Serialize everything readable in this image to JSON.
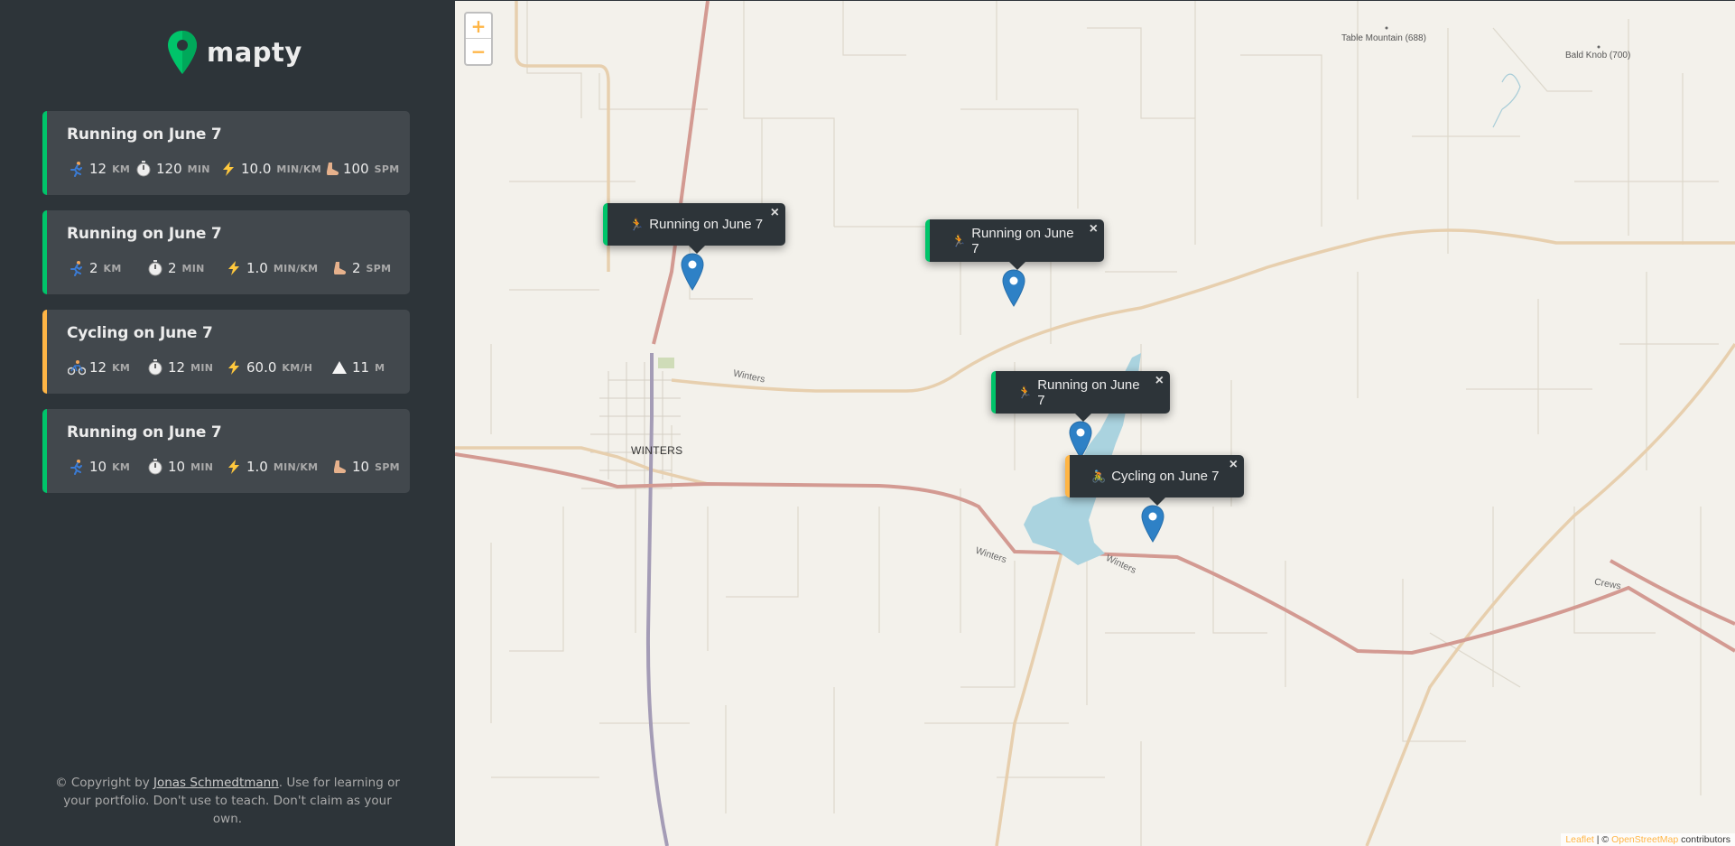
{
  "app": {
    "name": "mapty"
  },
  "workouts": [
    {
      "type": "running",
      "title": "Running on June 7",
      "distance": "12",
      "distance_unit": "km",
      "duration": "120",
      "duration_unit": "min",
      "pace": "10.0",
      "pace_unit": "min/km",
      "cadence": "100",
      "cadence_unit": "spm"
    },
    {
      "type": "running",
      "title": "Running on June 7",
      "distance": "2",
      "distance_unit": "km",
      "duration": "2",
      "duration_unit": "min",
      "pace": "1.0",
      "pace_unit": "min/km",
      "cadence": "2",
      "cadence_unit": "spm"
    },
    {
      "type": "cycling",
      "title": "Cycling on June 7",
      "distance": "12",
      "distance_unit": "km",
      "duration": "12",
      "duration_unit": "min",
      "speed": "60.0",
      "speed_unit": "km/h",
      "elevation": "11",
      "elevation_unit": "m"
    },
    {
      "type": "running",
      "title": "Running on June 7",
      "distance": "10",
      "distance_unit": "km",
      "duration": "10",
      "duration_unit": "min",
      "pace": "1.0",
      "pace_unit": "min/km",
      "cadence": "10",
      "cadence_unit": "spm"
    }
  ],
  "footer": {
    "prefix": "© Copyright by ",
    "author": "Jonas Schmedtmann",
    "suffix": ". Use for learning or your portfolio. Don't use to teach. Don't claim as your own."
  },
  "map": {
    "zoom_in": "+",
    "zoom_out": "−",
    "popups": [
      {
        "type": "running",
        "label": "Running on June 7",
        "close": "×"
      },
      {
        "type": "running",
        "label": "Running on June 7",
        "close": "×"
      },
      {
        "type": "running",
        "label": "Running on June 7",
        "close": "×"
      },
      {
        "type": "cycling",
        "label": "Cycling on June 7",
        "close": "×"
      }
    ],
    "places": {
      "table_mountain": "Table Mountain (688)",
      "bald_knob": "Bald Knob (700)",
      "town": "WINTERS",
      "road_winters_1": "Winters",
      "road_winters_2": "Winters",
      "road_winters_3": "Winters",
      "road_crews": "Crews"
    },
    "attribution": {
      "leaflet": "Leaflet",
      "sep": " | © ",
      "osm": "OpenStreetMap",
      "contributors": " contributors"
    }
  },
  "colors": {
    "running": "#00c46a",
    "cycling": "#ffb545",
    "dark": "#2d3439",
    "card": "#42484d"
  }
}
